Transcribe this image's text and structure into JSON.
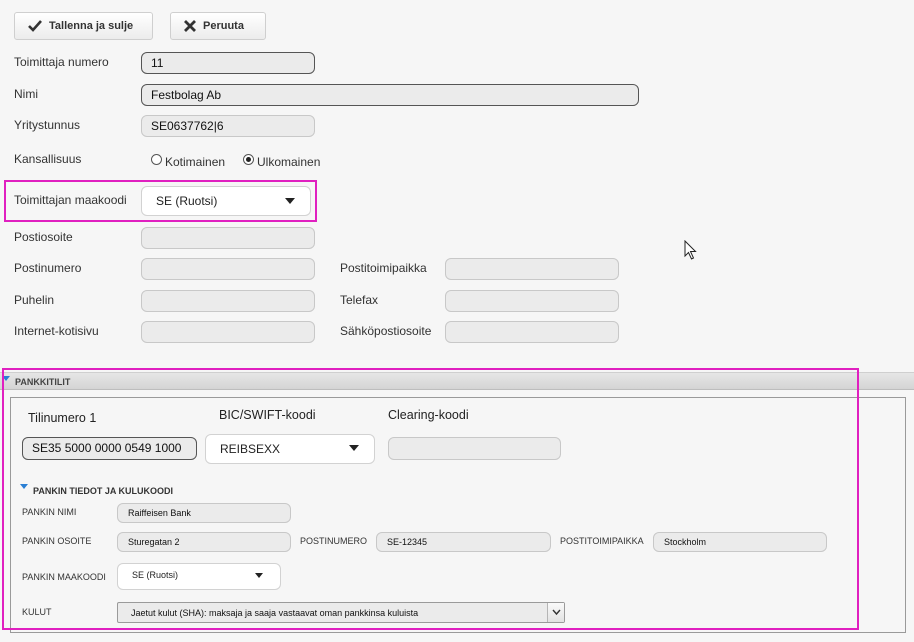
{
  "toolbar": {
    "save_label": "Tallenna ja sulje",
    "cancel_label": "Peruuta"
  },
  "supplier": {
    "number_label": "Toimittaja numero",
    "number_value": "11",
    "name_label": "Nimi",
    "name_value": "Festbolag Ab",
    "business_id_label": "Yritystunnus",
    "business_id_value": "SE0637762|6",
    "nationality_label": "Kansallisuus",
    "nationality_options": [
      "Kotimainen",
      "Ulkomainen"
    ],
    "nationality_selected": "Ulkomainen",
    "country_code_label": "Toimittajan maakoodi",
    "country_code_value": "SE (Ruotsi)",
    "postal_address_label": "Postiosoite",
    "postal_code_label": "Postinumero",
    "postal_city_label": "Postitoimipaikka",
    "phone_label": "Puhelin",
    "telefax_label": "Telefax",
    "homepage_label": "Internet-kotisivu",
    "email_label": "Sähköpostiosoite"
  },
  "bank_accounts": {
    "section_title": "PANKKITILIT",
    "account_label": "Tilinumero 1",
    "account_value": "SE35 5000 0000 0549 1000",
    "bic_label": "BIC/SWIFT-koodi",
    "bic_value": "REIBSEXX",
    "clearing_label": "Clearing-koodi",
    "bank_info": {
      "section_title": "PANKIN TIEDOT JA KULUKOODI",
      "bank_name_label": "PANKIN NIMI",
      "bank_name_value": "Raiffeisen Bank",
      "bank_address_label": "PANKIN OSOITE",
      "bank_address_value": "Sturegatan 2",
      "postal_code_label": "POSTINUMERO",
      "postal_code_value": "SE-12345",
      "postal_city_label": "POSTITOIMIPAIKKA",
      "postal_city_value": "Stockholm",
      "country_code_label": "PANKIN MAAKOODI",
      "country_code_value": "SE (Ruotsi)",
      "charges_label": "KULUT",
      "charges_value": "Jaetut kulut (SHA): maksaja ja saaja vastaavat oman pankkinsa kuluista"
    }
  },
  "colors": {
    "highlight": "#e020c0",
    "section_arrow": "#2a7fd4"
  }
}
